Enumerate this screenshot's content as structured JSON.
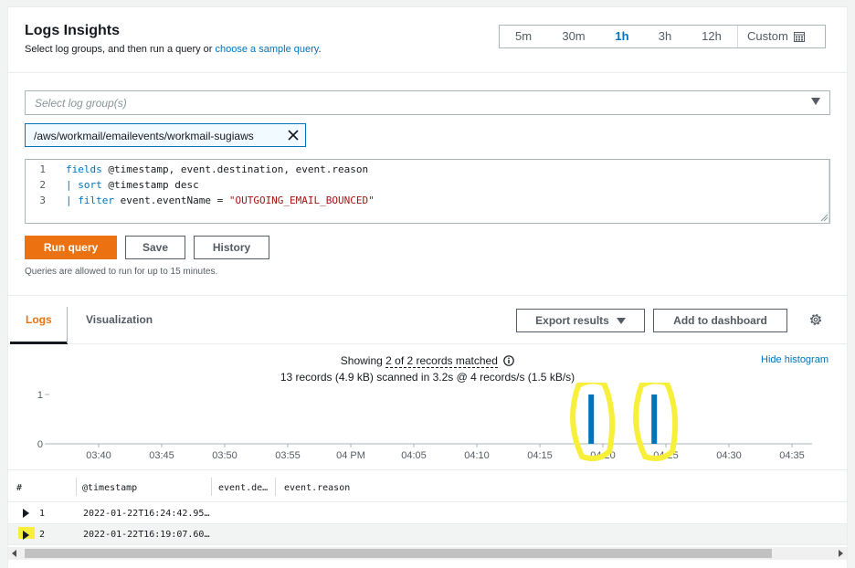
{
  "header": {
    "title": "Logs Insights",
    "subtitle_prefix": "Select log groups, and then run a query or ",
    "subtitle_link": "choose a sample query",
    "subtitle_suffix": "."
  },
  "time_ranges": {
    "items": [
      "5m",
      "30m",
      "1h",
      "3h",
      "12h"
    ],
    "active": "1h",
    "custom_label": "Custom"
  },
  "log_group": {
    "placeholder": "Select log group(s)",
    "selected": "/aws/workmail/emailevents/workmail-sugiaws"
  },
  "query": {
    "line_numbers": [
      "1",
      "2",
      "3"
    ],
    "lines": [
      [
        "fields",
        " @timestamp, event.destination, event.reason"
      ],
      [
        "| sort",
        " @timestamp desc"
      ],
      [
        "| filter",
        " event.eventName = ",
        "\"OUTGOING_EMAIL_BOUNCED\""
      ]
    ]
  },
  "actions": {
    "run": "Run query",
    "save": "Save",
    "history": "History",
    "note": "Queries are allowed to run for up to 15 minutes."
  },
  "tabs": {
    "logs": "Logs",
    "visualization": "Visualization",
    "export": "Export results",
    "add_dashboard": "Add to dashboard"
  },
  "results": {
    "showing_prefix": "Showing ",
    "showing_value": "2 of 2 records matched",
    "scanned": "13 records (4.9 kB) scanned in 3.2s @ 4 records/s (1.5 kB/s)",
    "hide_histogram": "Hide histogram"
  },
  "chart_data": {
    "type": "bar",
    "x": [
      "03:40",
      "03:45",
      "03:50",
      "03:55",
      "04 PM",
      "04:05",
      "04:10",
      "04:15",
      "04:20",
      "04:25",
      "04:30",
      "04:35"
    ],
    "bars": [
      {
        "x": "04:19",
        "value": 1
      },
      {
        "x": "04:24",
        "value": 1
      }
    ],
    "y_ticks": [
      "0",
      "1"
    ],
    "ylim": [
      0,
      1
    ],
    "bar_color": "#0073bb",
    "highlight_color": "#f7ef3a"
  },
  "table": {
    "headers": [
      "#",
      "@timestamp",
      "event.de…",
      "event.reason"
    ],
    "rows": [
      {
        "index": "1",
        "timestamp": "2022-01-22T16:24:42.95…"
      },
      {
        "index": "2",
        "timestamp": "2022-01-22T16:19:07.60…"
      }
    ]
  }
}
